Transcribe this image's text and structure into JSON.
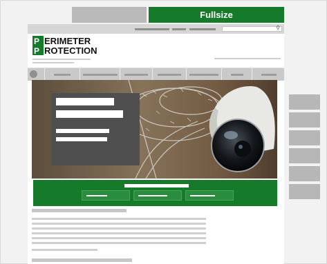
{
  "tabs": {
    "left_label": "",
    "right_label": "Fullsize"
  },
  "logo": {
    "line1": "ERIMETER",
    "line2": "ROTECTION",
    "initial1": "P",
    "initial2": "P"
  },
  "colors": {
    "accent": "#167a2b",
    "placeholder_gray": "#b9b9b9"
  },
  "icons": {
    "search": "search-icon",
    "home": "home-icon"
  }
}
